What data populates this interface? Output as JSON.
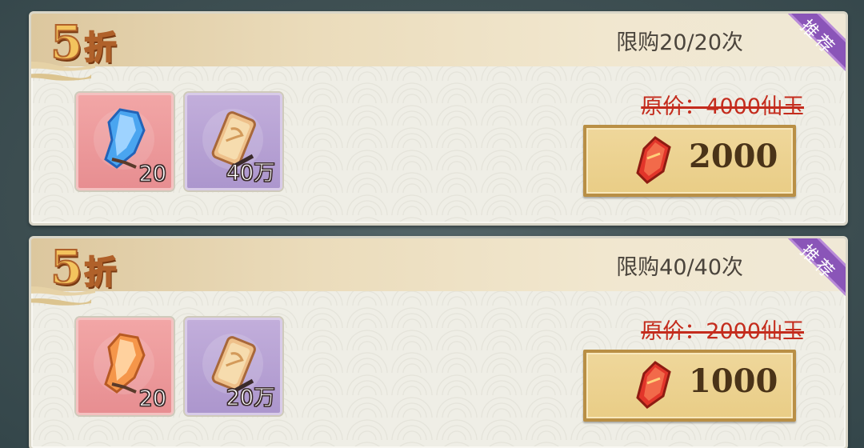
{
  "offers": [
    {
      "discount_num": "5",
      "discount_suffix": "折",
      "limit": "限购20/20次",
      "ribbon": "推荐",
      "items": [
        {
          "icon": "blue-crystal-icon",
          "qty": "20"
        },
        {
          "icon": "gold-token-icon",
          "qty": "40万"
        }
      ],
      "original_price": "原价：4000仙玉",
      "price": "2000",
      "currency_icon": "red-jade-icon"
    },
    {
      "discount_num": "5",
      "discount_suffix": "折",
      "limit": "限购40/40次",
      "ribbon": "推荐",
      "items": [
        {
          "icon": "orange-crystal-icon",
          "qty": "20"
        },
        {
          "icon": "gold-token-icon",
          "qty": "20万"
        }
      ],
      "original_price": "原价：2000仙玉",
      "price": "1000",
      "currency_icon": "red-jade-icon"
    }
  ],
  "colors": {
    "discount": "#f3c35d",
    "strike_price": "#c42c1d",
    "ribbon": "#8a55b8",
    "button": "#e9cd86"
  }
}
